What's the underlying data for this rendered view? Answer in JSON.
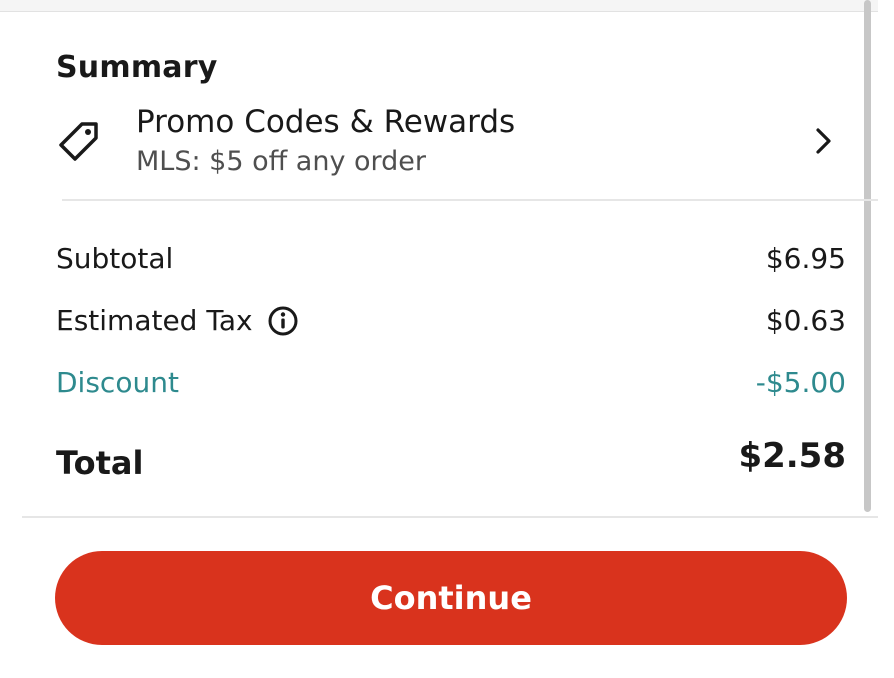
{
  "summary": {
    "title": "Summary"
  },
  "promo": {
    "icon": "tag-icon",
    "title": "Promo Codes & Rewards",
    "subtitle": "MLS: $5 off any order",
    "chevron_icon": "chevron-right-icon"
  },
  "lines": {
    "subtotal": {
      "label": "Subtotal",
      "value": "$6.95"
    },
    "tax": {
      "label": "Estimated Tax",
      "value": "$0.63",
      "info_icon": "info-icon"
    },
    "discount": {
      "label": "Discount",
      "value": "-$5.00"
    },
    "total": {
      "label": "Total",
      "value": "$2.58"
    }
  },
  "continue_button": {
    "label": "Continue"
  },
  "colors": {
    "accent_red": "#d9331d",
    "discount_teal": "#2e8a8e",
    "text_dark": "#191919",
    "text_secondary": "#4f4f4f"
  }
}
